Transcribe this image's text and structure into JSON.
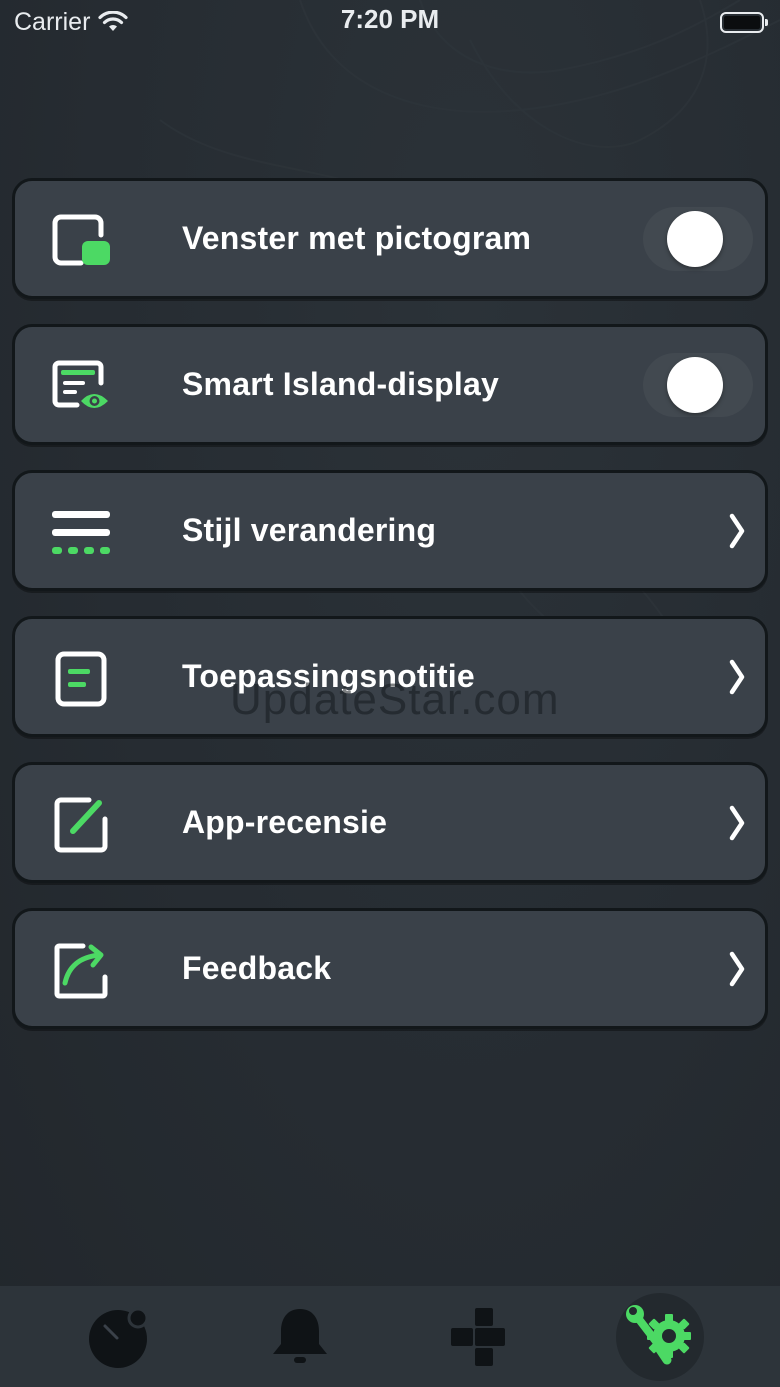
{
  "status_bar": {
    "carrier": "Carrier",
    "time": "7:20 PM"
  },
  "menu": {
    "items": [
      {
        "label": "Venster met pictogram",
        "icon": "picture-in-picture-icon",
        "control": "toggle",
        "on": false
      },
      {
        "label": "Smart Island-display",
        "icon": "display-eye-icon",
        "control": "toggle",
        "on": false
      },
      {
        "label": "Stijl verandering",
        "icon": "style-lines-icon",
        "control": "chevron"
      },
      {
        "label": "Toepassingsnotitie",
        "icon": "note-icon",
        "control": "chevron"
      },
      {
        "label": "App-recensie",
        "icon": "edit-square-icon",
        "control": "chevron"
      },
      {
        "label": "Feedback",
        "icon": "share-arrow-icon",
        "control": "chevron"
      }
    ]
  },
  "watermark": "UpdateStar.com",
  "tab_bar": {
    "tabs": [
      {
        "icon": "dynamic-island-icon",
        "active": false
      },
      {
        "icon": "bell-icon",
        "active": false
      },
      {
        "icon": "widgets-icon",
        "active": false
      },
      {
        "icon": "settings-tools-icon",
        "active": true
      }
    ]
  },
  "colors": {
    "accent": "#4cd964",
    "row_bg": "#3a4149",
    "row_border": "#12171a",
    "background": "#252b31",
    "tab_bar_bg": "#2d343a"
  }
}
